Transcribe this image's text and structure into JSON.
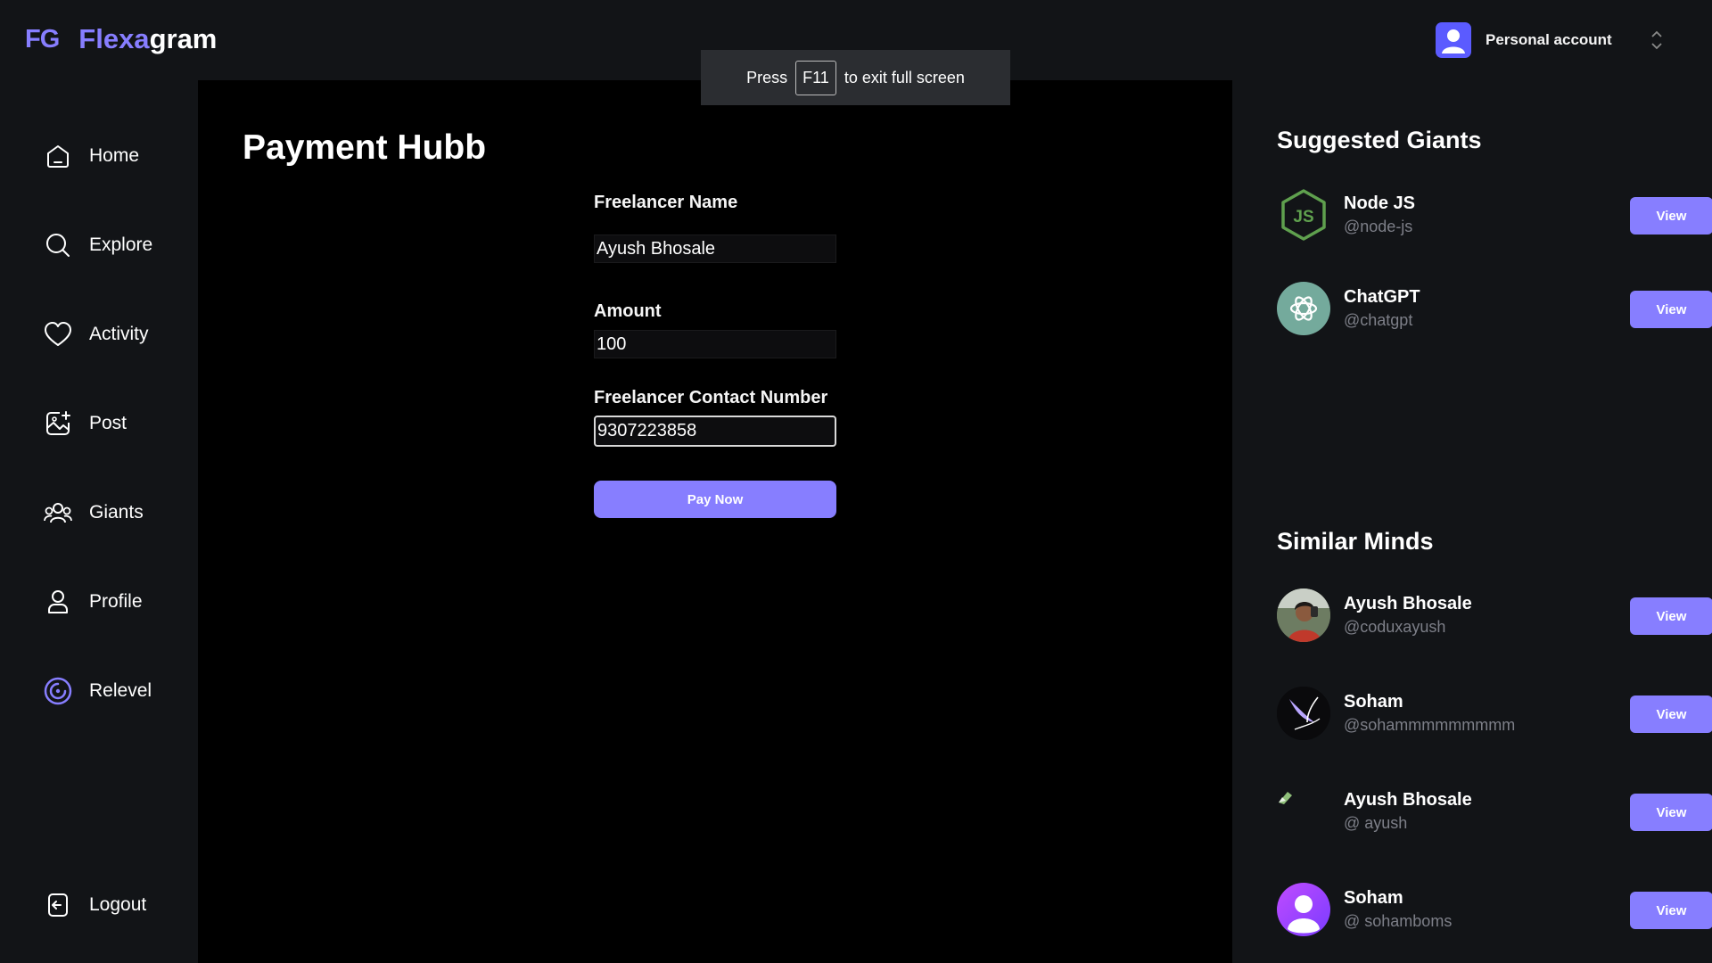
{
  "brand": {
    "mark": "FG",
    "name_part1": "Flexa",
    "name_part2": "gram"
  },
  "account": {
    "label": "Personal account"
  },
  "toast": {
    "prefix": "Press",
    "key": "F11",
    "suffix": "to exit full screen"
  },
  "sidebar": {
    "items": [
      {
        "label": "Home",
        "icon": "home-icon"
      },
      {
        "label": "Explore",
        "icon": "search-icon"
      },
      {
        "label": "Activity",
        "icon": "heart-icon"
      },
      {
        "label": "Post",
        "icon": "image-plus-icon"
      },
      {
        "label": "Giants",
        "icon": "people-icon"
      },
      {
        "label": "Profile",
        "icon": "user-icon"
      },
      {
        "label": "Relevel",
        "icon": "relevel-icon"
      }
    ],
    "logout": {
      "label": "Logout",
      "icon": "logout-icon"
    }
  },
  "main": {
    "title": "Payment Hubb",
    "form": {
      "name_label": "Freelancer Name",
      "name_value": "Ayush Bhosale",
      "amount_label": "Amount",
      "amount_value": "100",
      "contact_label": "Freelancer Contact Number",
      "contact_value": "9307223858",
      "submit_label": "Pay Now"
    }
  },
  "right": {
    "suggested_title": "Suggested Giants",
    "suggested": [
      {
        "name": "Node JS",
        "handle": "@node-js",
        "view": "View",
        "avatar": "nodejs-logo"
      },
      {
        "name": "ChatGPT",
        "handle": "@chatgpt",
        "view": "View",
        "avatar": "chatgpt-logo"
      }
    ],
    "similar_title": "Similar Minds",
    "similar": [
      {
        "name": "Ayush Bhosale",
        "handle": "@coduxayush",
        "view": "View",
        "avatar": "photo-avatar"
      },
      {
        "name": "Soham",
        "handle": "@sohammmmmmmmm",
        "view": "View",
        "avatar": "bird-avatar"
      },
      {
        "name": "Ayush Bhosale",
        "handle": "@ ayush",
        "view": "View",
        "avatar": "broken-image-avatar"
      },
      {
        "name": "Soham",
        "handle": "@ sohamboms",
        "view": "View",
        "avatar": "default-user-avatar"
      }
    ]
  },
  "colors": {
    "accent": "#877eff",
    "background": "#121417",
    "main_panel": "#000000",
    "muted_text": "#7d7f88"
  }
}
